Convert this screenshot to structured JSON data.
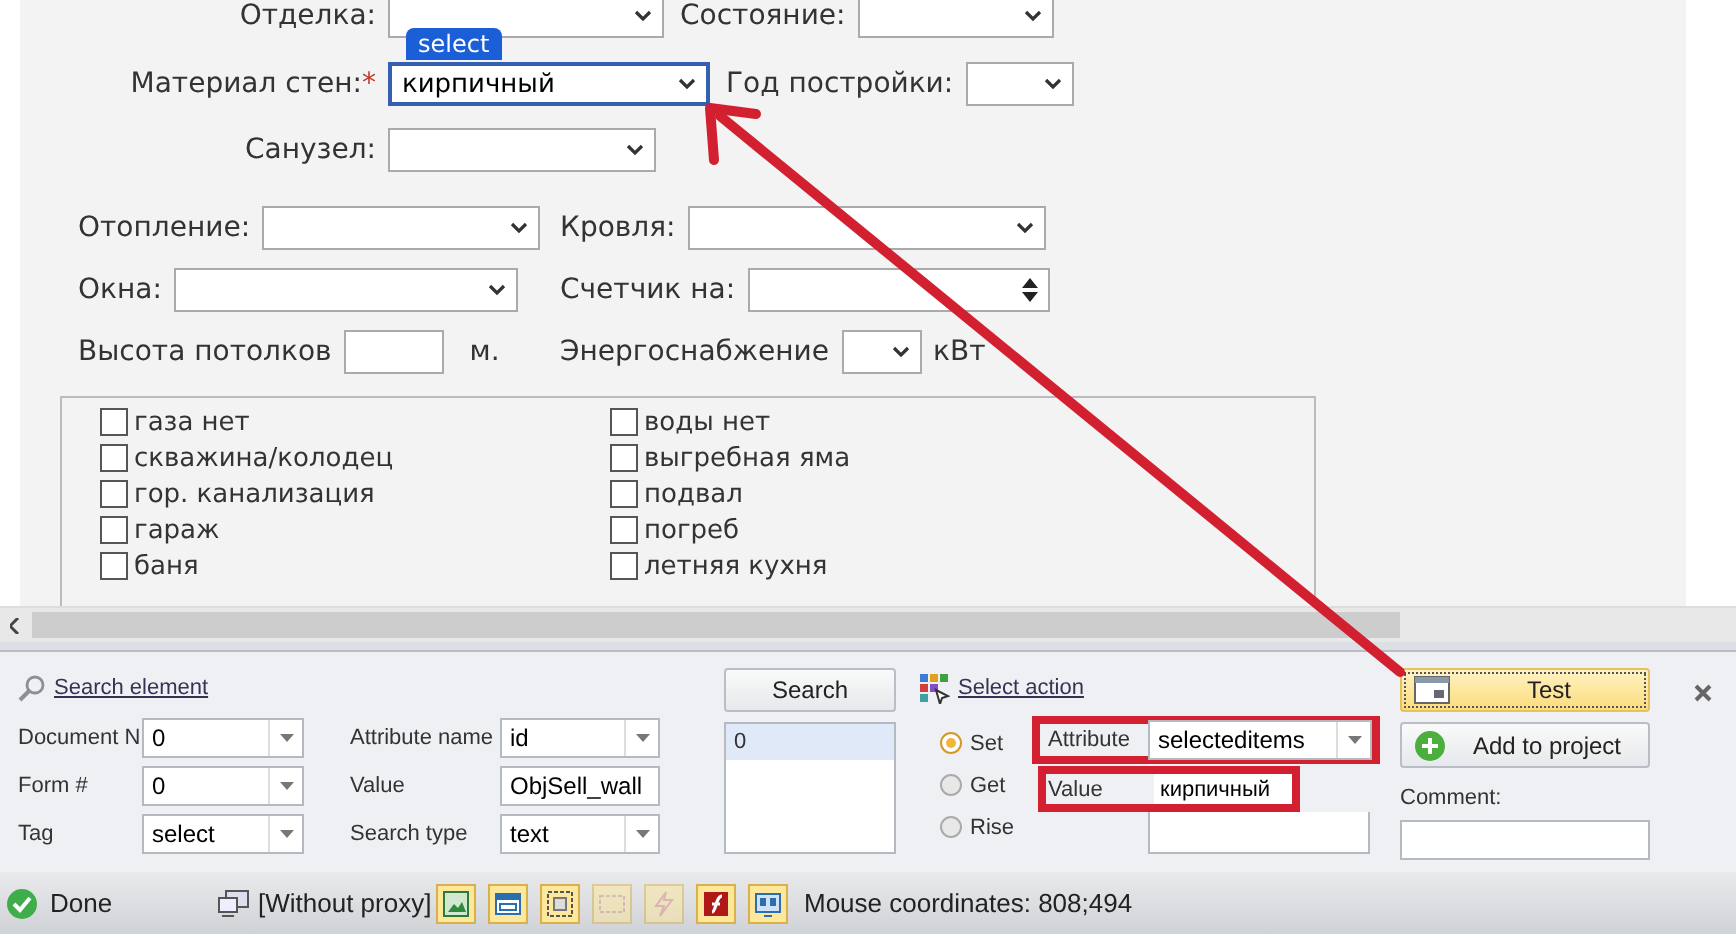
{
  "form": {
    "rows": [
      {
        "fields": [
          {
            "label": "Отделка:",
            "kind": "select"
          },
          {
            "label": "Состояние:",
            "kind": "select"
          }
        ]
      },
      {
        "fields": [
          {
            "label": "Материал стен:",
            "required_mark": "*",
            "kind": "select",
            "value": "кирпичный",
            "highlighted": true,
            "tag": "select"
          },
          {
            "label": "Год постройки:",
            "kind": "select"
          }
        ]
      },
      {
        "fields": [
          {
            "label": "Санузел:",
            "kind": "select"
          }
        ]
      },
      {
        "fields": [
          {
            "label": "Отопление:",
            "kind": "select"
          },
          {
            "label": "Кровля:",
            "kind": "select"
          }
        ]
      },
      {
        "fields": [
          {
            "label": "Окна:",
            "kind": "select"
          },
          {
            "label": "Счетчик на:",
            "kind": "spinner"
          }
        ]
      },
      {
        "fields": [
          {
            "label": "Высота потолков",
            "kind": "text",
            "unit": "м."
          },
          {
            "label": "Энергоснабжение",
            "kind": "select",
            "unit": "кВт"
          }
        ]
      }
    ],
    "checkboxes": [
      {
        "label": "газа нет",
        "checked": false
      },
      {
        "label": "воды нет",
        "checked": false
      },
      {
        "label": "скважина/колодец",
        "checked": false
      },
      {
        "label": "выгребная яма",
        "checked": false
      },
      {
        "label": "гор. канализация",
        "checked": false
      },
      {
        "label": "подвал",
        "checked": false
      },
      {
        "label": "гараж",
        "checked": false
      },
      {
        "label": "погреб",
        "checked": false
      },
      {
        "label": "баня",
        "checked": false
      },
      {
        "label": "летняя кухня",
        "checked": false
      }
    ]
  },
  "panel": {
    "search_link": "Search element",
    "left_fields": [
      {
        "label": "Document N",
        "value": "0",
        "kind": "combo"
      },
      {
        "label": "Form #",
        "value": "0",
        "kind": "combo"
      },
      {
        "label": "Tag",
        "value": "select",
        "kind": "combo"
      }
    ],
    "mid_fields": [
      {
        "label": "Attribute name",
        "value": "id",
        "kind": "combo"
      },
      {
        "label": "Value",
        "value": "ObjSell_wall",
        "kind": "text"
      },
      {
        "label": "Search type",
        "value": "text",
        "kind": "combo"
      }
    ],
    "search_button": "Search",
    "results": [
      {
        "text": "0",
        "selected": true
      }
    ],
    "action_link": "Select action",
    "modes": [
      {
        "label": "Set",
        "selected": true
      },
      {
        "label": "Get",
        "selected": false
      },
      {
        "label": "Rise",
        "selected": false
      }
    ],
    "attribute": {
      "label": "Attribute",
      "value": "selecteditems"
    },
    "value": {
      "label": "Value",
      "value": "кирпичный"
    },
    "test_button": "Test",
    "add_button": "Add to project",
    "comment_label": "Comment:"
  },
  "status_bar": {
    "status": "Done",
    "proxy": "[Without proxy]",
    "tools": [
      {
        "kind": "image",
        "disabled": false
      },
      {
        "kind": "window",
        "disabled": false
      },
      {
        "kind": "frame",
        "disabled": false
      },
      {
        "kind": "css",
        "disabled": true
      },
      {
        "kind": "bolt",
        "disabled": true
      },
      {
        "kind": "flash",
        "disabled": false
      },
      {
        "kind": "screen",
        "disabled": false
      }
    ],
    "mouse": "Mouse coordinates: 808;494"
  }
}
